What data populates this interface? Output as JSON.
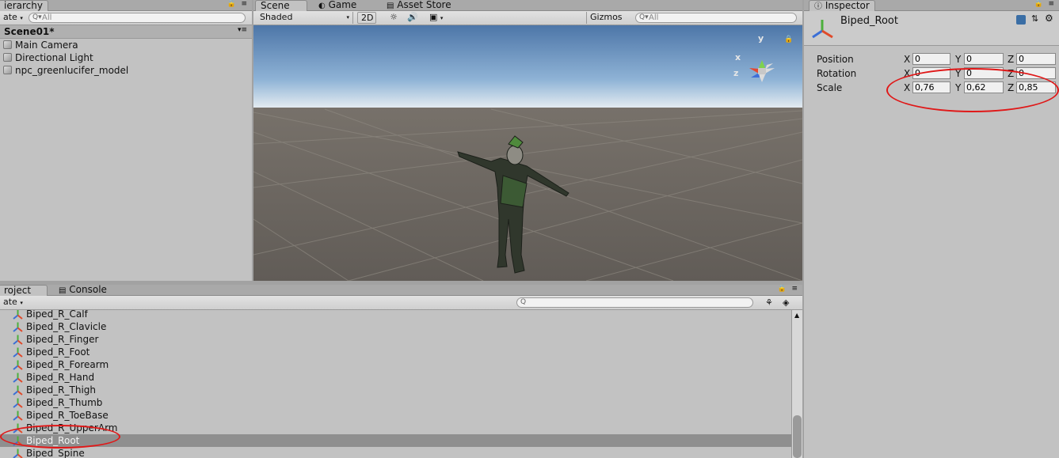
{
  "hierarchy": {
    "tab": "ierarchy",
    "create": "ate",
    "search_placeholder": "All",
    "scene": "Scene01*",
    "items": [
      "Main Camera",
      "Directional Light",
      "npc_greenlucifer_model"
    ]
  },
  "scene_view": {
    "tabs": [
      "Scene",
      "Game",
      "Asset Store"
    ],
    "shading": "Shaded",
    "mode_2d": "2D",
    "gizmos": "Gizmos",
    "search_placeholder": "All",
    "axis": {
      "y": "y",
      "x": "x",
      "z": "z"
    }
  },
  "inspector": {
    "tab": "Inspector",
    "object_name": "Biped_Root",
    "position": {
      "label": "Position",
      "x": "0",
      "y": "0",
      "z": "0"
    },
    "rotation": {
      "label": "Rotation",
      "x": "0",
      "y": "0",
      "z": "0"
    },
    "scale": {
      "label": "Scale",
      "x": "0,76",
      "y": "0,62",
      "z": "0,85"
    },
    "axis_labels": [
      "X",
      "Y",
      "Z"
    ]
  },
  "project": {
    "tabs": [
      "roject",
      "Console"
    ],
    "create": "ate",
    "items": [
      "Biped_R_Calf",
      "Biped_R_Clavicle",
      "Biped_R_Finger",
      "Biped_R_Foot",
      "Biped_R_Forearm",
      "Biped_R_Hand",
      "Biped_R_Thigh",
      "Biped_R_Thumb",
      "Biped_R_ToeBase",
      "Biped_R_UpperArm",
      "Biped_Root",
      "Biped_Spine"
    ],
    "selected_index": 10
  },
  "colors": {
    "annotation": "#e01818",
    "selection": "#8f8f8f",
    "sky": "#5c86b8",
    "ground": "#6b6660"
  }
}
